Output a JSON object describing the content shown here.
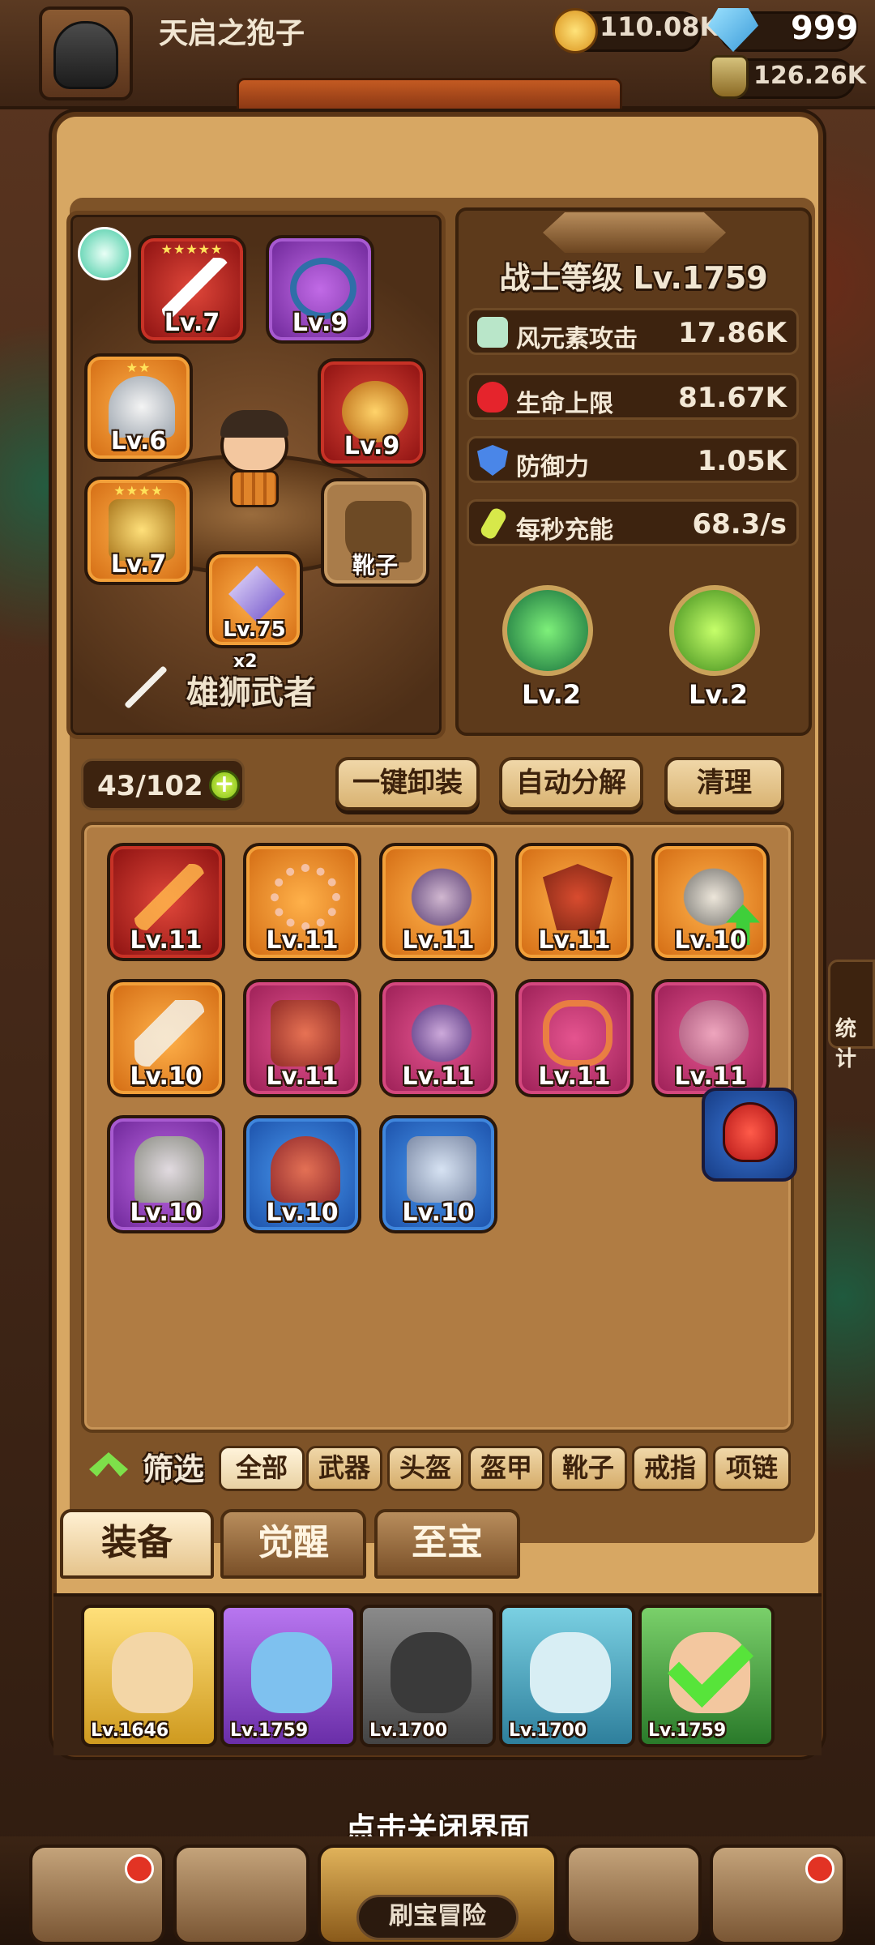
{
  "topbar": {
    "player_name": "天启之狍子",
    "gold": "110.08K",
    "gems": "999",
    "jars": "126.26K"
  },
  "hero": {
    "name": "雄狮武者",
    "weapon_multiplier": "x2"
  },
  "equipped": [
    {
      "slot": "weapon",
      "level": "Lv.7",
      "rarity": "red",
      "stars": "★★★★★"
    },
    {
      "slot": "necklace",
      "level": "Lv.9",
      "rarity": "purple",
      "stars": ""
    },
    {
      "slot": "helmet",
      "level": "Lv.6",
      "rarity": "orange",
      "stars": "★★"
    },
    {
      "slot": "ring",
      "level": "Lv.9",
      "rarity": "red",
      "stars": ""
    },
    {
      "slot": "armor",
      "level": "Lv.7",
      "rarity": "orange",
      "stars": "★★★★"
    },
    {
      "slot": "boots",
      "label": "靴子",
      "rarity": "empty"
    },
    {
      "slot": "gem",
      "level": "Lv.75",
      "rarity": "orange"
    }
  ],
  "stats": {
    "warrior_level": "战士等级 Lv.1759",
    "rows": [
      {
        "label": "风元素攻击",
        "value": "17.86K",
        "icon": "wind-attack-icon",
        "color": "#b9e6c9"
      },
      {
        "label": "生命上限",
        "value": "81.67K",
        "icon": "heart-icon",
        "color": "#e5242c"
      },
      {
        "label": "防御力",
        "value": "1.05K",
        "icon": "shield-icon",
        "color": "#4a86e8"
      },
      {
        "label": "每秒充能",
        "value": "68.3/s",
        "icon": "energy-icon",
        "color": "#d7e84a"
      }
    ],
    "skills": [
      {
        "level": "Lv.2"
      },
      {
        "level": "Lv.2"
      }
    ]
  },
  "inventory": {
    "capacity": "43/102",
    "actions": {
      "unequip_all": "一键卸装",
      "auto_decompose": "自动分解",
      "clean": "清理"
    },
    "items": [
      {
        "level": "Lv.11",
        "rarity": "red"
      },
      {
        "level": "Lv.11",
        "rarity": "orange"
      },
      {
        "level": "Lv.11",
        "rarity": "orange"
      },
      {
        "level": "Lv.11",
        "rarity": "orange"
      },
      {
        "level": "Lv.10",
        "rarity": "orange",
        "upgrade": true
      },
      {
        "level": "Lv.10",
        "rarity": "orange"
      },
      {
        "level": "Lv.11",
        "rarity": "pink"
      },
      {
        "level": "Lv.11",
        "rarity": "pink"
      },
      {
        "level": "Lv.11",
        "rarity": "pink"
      },
      {
        "level": "Lv.11",
        "rarity": "pink"
      },
      {
        "level": "Lv.10",
        "rarity": "purple"
      },
      {
        "level": "Lv.10",
        "rarity": "blue"
      },
      {
        "level": "Lv.10",
        "rarity": "blue"
      }
    ]
  },
  "filter": {
    "label": "筛选",
    "chips": [
      "全部",
      "武器",
      "头盔",
      "盔甲",
      "靴子",
      "戒指",
      "项链"
    ],
    "active": "全部"
  },
  "tabs": [
    "装备",
    "觉醒",
    "至宝"
  ],
  "heroes": [
    {
      "level": "Lv.1646",
      "style": "gold"
    },
    {
      "level": "Lv.1759",
      "style": "purple"
    },
    {
      "level": "Lv.1700",
      "style": "dark"
    },
    {
      "level": "Lv.1700",
      "style": "teal"
    },
    {
      "level": "Lv.1759",
      "style": "green",
      "selected": true
    }
  ],
  "bottom": {
    "close_hint": "点击关闭界面",
    "adventure_label": "刷宝冒险"
  },
  "side": {
    "stats_label": "统计"
  }
}
